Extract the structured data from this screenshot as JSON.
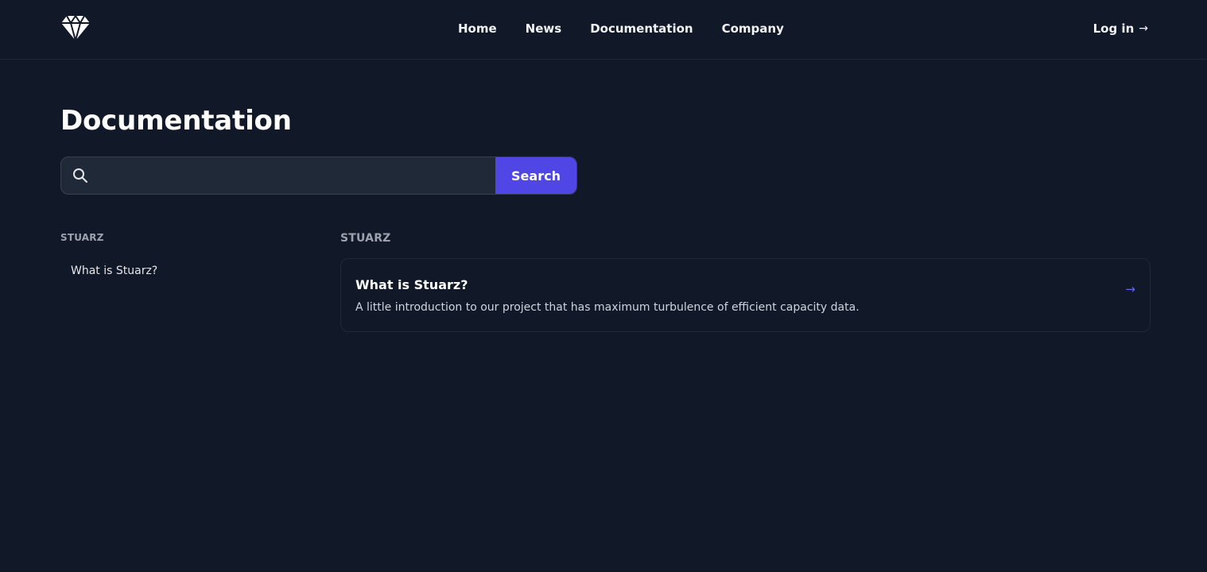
{
  "header": {
    "logo_icon": "diamond-icon",
    "nav": [
      {
        "label": "Home"
      },
      {
        "label": "News"
      },
      {
        "label": "Documentation"
      },
      {
        "label": "Company"
      }
    ],
    "login": {
      "label": "Log in",
      "arrow": "→"
    }
  },
  "page": {
    "title": "Documentation"
  },
  "search": {
    "placeholder": "",
    "value": "",
    "button_label": "Search",
    "icon": "search-icon"
  },
  "sidebar": {
    "heading": "STUARZ",
    "items": [
      {
        "label": "What is Stuarz?"
      }
    ]
  },
  "main": {
    "section_heading": "STUARZ",
    "cards": [
      {
        "title": "What is Stuarz?",
        "description": "A little introduction to our project that has maximum turbulence of efficient capacity data.",
        "arrow": "→"
      }
    ]
  },
  "colors": {
    "background": "#111827",
    "accent": "#4f46e5",
    "border": "#1f2937",
    "muted": "#9ca3af"
  }
}
